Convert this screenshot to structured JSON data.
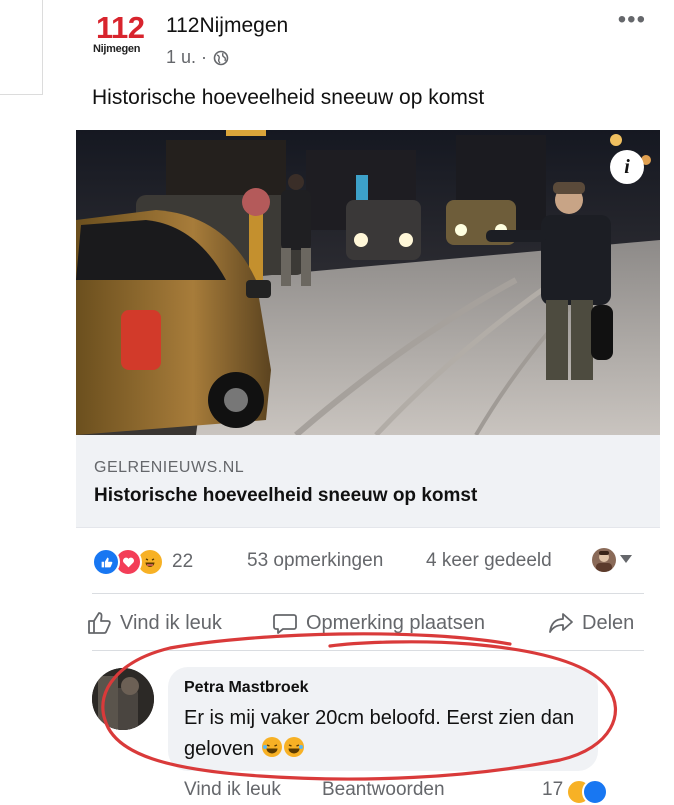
{
  "post": {
    "logo": {
      "number": "112",
      "city": "Nijmegen"
    },
    "page_name": "112Nijmegen",
    "time": "1 u. ·",
    "more_label": "•••",
    "text": "Historische hoeveelheid sneeuw op komst",
    "info_label": "i",
    "link": {
      "domain": "GELRENIEUWS.NL",
      "title": "Historische hoeveelheid sneeuw op komst"
    }
  },
  "stats": {
    "reaction_count": "22",
    "comments": "53 opmerkingen",
    "shares": "4 keer gedeeld"
  },
  "actions": {
    "like": "Vind ik leuk",
    "comment": "Opmerking plaatsen",
    "share": "Delen"
  },
  "comment": {
    "author": "Petra Mastbroek",
    "text": "Er is mij vaker 20cm beloofd. Eerst zien dan geloven",
    "like": "Vind ik leuk",
    "reply": "Beantwoorden",
    "reaction_count": "17"
  },
  "colors": {
    "like_blue": "#1877f2",
    "love_red": "#f33e58",
    "haha_yellow": "#f7b125",
    "logo_red": "#d8242d",
    "annotation_red": "#d93a3a"
  }
}
